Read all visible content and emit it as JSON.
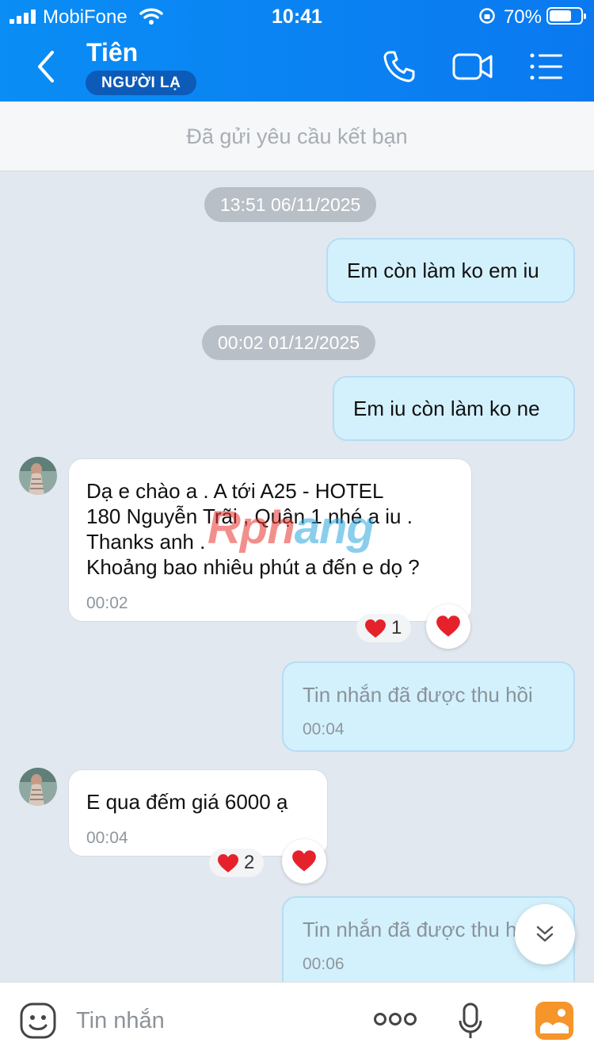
{
  "status_bar": {
    "carrier": "MobiFone",
    "time": "10:41",
    "battery_pct": "70%",
    "battery_level": 0.7
  },
  "header": {
    "contact_name": "Tiên",
    "badge": "NGƯỜI LẠ"
  },
  "friend_request": "Đã gửi yêu cầu kết bạn",
  "chat": {
    "stamp1": "13:51 06/11/2025",
    "stamp2": "00:02 01/12/2025",
    "msg1": "Em còn làm ko em iu",
    "msg2": "Em iu còn làm ko ne",
    "msg3": {
      "lines": [
        "Dạ e chào a . A tới A25 - HOTEL",
        "180 Nguyễn Trãi , Quận 1 nhé a iu .",
        "Thanks anh .",
        "Khoảng bao nhiêu phút a đến e dọ ?"
      ],
      "time": "00:02",
      "reactions": "1"
    },
    "msg4": {
      "text": "Tin nhắn đã được thu hồi",
      "time": "00:04"
    },
    "msg5": {
      "text": "E qua đếm giá 6000 ạ",
      "time": "00:04",
      "reactions": "2"
    },
    "msg6": {
      "text": "Tin nhắn đã được thu hồi",
      "time": "00:06"
    }
  },
  "watermark": {
    "part1": "Rph",
    "part2": "ang"
  },
  "input": {
    "placeholder": "Tin nhắn"
  },
  "colors": {
    "header": "#0a8df5",
    "out_bubble": "#d3f1fd",
    "badge": "#0c5bb8",
    "heart": "#e5222b"
  }
}
